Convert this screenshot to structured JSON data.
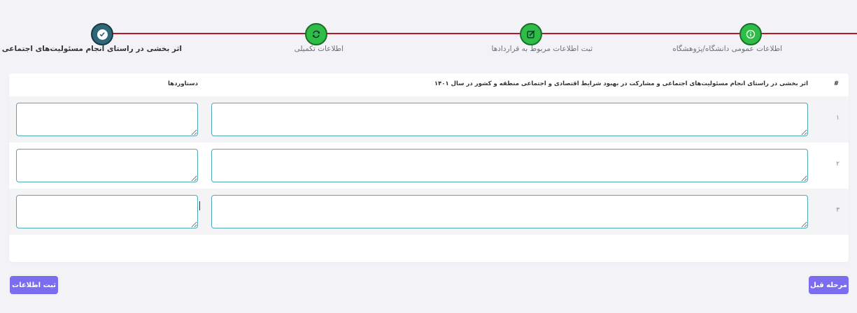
{
  "stepper": {
    "steps": [
      {
        "label": "اطلاعات عمومی دانشگاه/پژوهشگاه",
        "icon": "info-icon",
        "state": "completed"
      },
      {
        "label": "ثبت اطلاعات مربوط به قراردادها",
        "icon": "edit-icon",
        "state": "completed"
      },
      {
        "label": "اطلاعات تکمیلی",
        "icon": "refresh-icon",
        "state": "completed"
      },
      {
        "label": "اثر بخشی در راستای انجام مسئولیت‌های اجتماعی",
        "icon": "check-icon",
        "state": "active"
      }
    ],
    "colors": {
      "line": "#b5162a",
      "completed": "#2ebd46",
      "active": "#2f6678"
    }
  },
  "table": {
    "headers": {
      "number": "#",
      "main": "اثر بخشی در راستای انجام مسئولیت‌های اجتماعی و مشارکت در بهبود شرایط اقتصادی و اجتماعی منطقه و کشور در سال ۱۴۰۱",
      "achievements": "دستاوردها"
    },
    "rows": [
      {
        "number": "۱",
        "main": "",
        "achievements": ""
      },
      {
        "number": "۲",
        "main": "",
        "achievements": ""
      },
      {
        "number": "۳",
        "main": "",
        "achievements": ""
      }
    ]
  },
  "actions": {
    "submit_label": "ثبت اطلاعات",
    "previous_label": "مرحله قبل",
    "button_color": "#7b6cf0"
  }
}
